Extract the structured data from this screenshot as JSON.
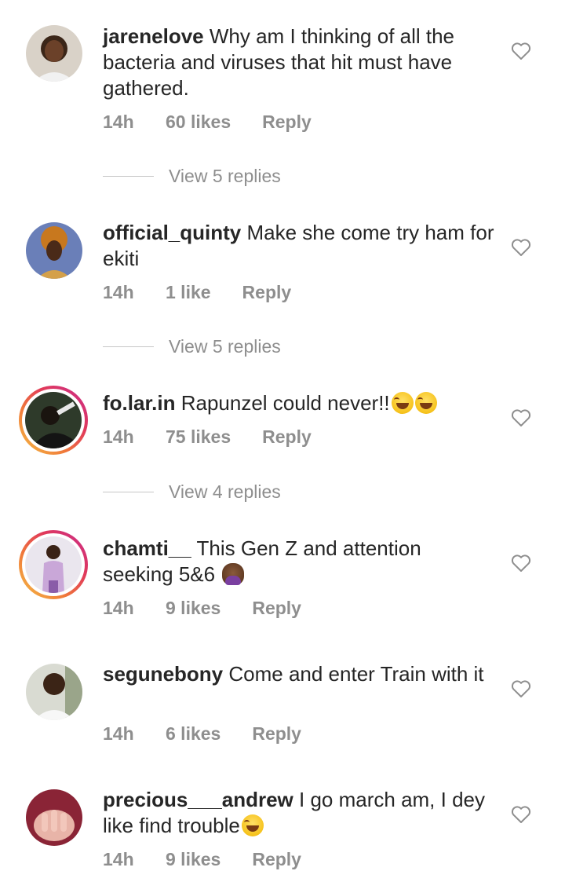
{
  "comments": [
    {
      "username": "jarenelove",
      "text": "Why am I thinking of all the bacteria and viruses that hit must have gathered.",
      "time": "14h",
      "likes": "60 likes",
      "reply": "Reply",
      "view_replies": "View 5 replies"
    },
    {
      "username": "official_quinty",
      "text": "Make she come try ham for ekiti",
      "time": "14h",
      "likes": "1 like",
      "reply": "Reply",
      "view_replies": "View 5 replies"
    },
    {
      "username": "fo.lar.in",
      "text": "Rapunzel could never!!",
      "emoji": "laughing-emoji",
      "time": "14h",
      "likes": "75 likes",
      "reply": "Reply",
      "view_replies": "View 4 replies"
    },
    {
      "username": "chamti__",
      "text": "This Gen Z and attention seeking 5&6",
      "emoji": "facepalm-emoji",
      "time": "14h",
      "likes": "9 likes",
      "reply": "Reply"
    },
    {
      "username": "segunebony",
      "text": "Come and enter Train  with it",
      "time": "14h",
      "likes": "6 likes",
      "reply": "Reply"
    },
    {
      "username": "precious___andrew",
      "text": "I go march am, I dey like find trouble",
      "emoji": "laughing-emoji",
      "time": "14h",
      "likes": "9 likes",
      "reply": "Reply"
    }
  ],
  "icons": {
    "heart": "heart-outline-icon"
  },
  "colors": {
    "text": "#262626",
    "muted": "#8e8e8e",
    "story_ring_start": "#f5c046",
    "story_ring_end": "#c82b8e"
  }
}
